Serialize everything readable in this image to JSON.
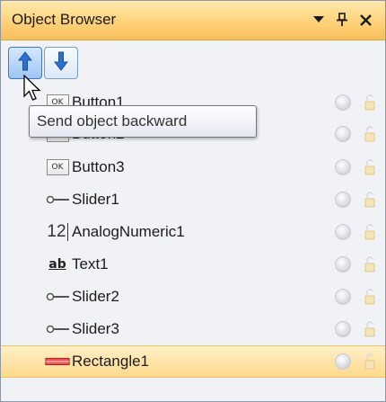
{
  "panel": {
    "title": "Object Browser",
    "dropdown_glyph": "▾",
    "pin_glyph": "ᵠ",
    "close_glyph": "✕"
  },
  "toolbar": {
    "bring_forward_icon": "arrow-up-icon",
    "send_backward_icon": "arrow-down-icon"
  },
  "tooltip": {
    "text": "Send object backward"
  },
  "objects": [
    {
      "label": "Button1",
      "icon": "button-icon",
      "icon_text": "OK",
      "selected": false
    },
    {
      "label": "Button2",
      "icon": "button-icon",
      "icon_text": "OK",
      "selected": false
    },
    {
      "label": "Button3",
      "icon": "button-icon",
      "icon_text": "OK",
      "selected": false
    },
    {
      "label": "Slider1",
      "icon": "slider-icon",
      "selected": false
    },
    {
      "label": "AnalogNumeric1",
      "icon": "numeric-icon",
      "icon_text": "12",
      "selected": false
    },
    {
      "label": "Text1",
      "icon": "text-icon",
      "icon_text": "ab",
      "selected": false
    },
    {
      "label": "Slider2",
      "icon": "slider-icon",
      "selected": false
    },
    {
      "label": "Slider3",
      "icon": "slider-icon",
      "selected": false
    },
    {
      "label": "Rectangle1",
      "icon": "rectangle-icon",
      "selected": true
    }
  ],
  "colors": {
    "selection": "#ffd98c",
    "titlebar": "#ffd27a",
    "accent": "#3e78c0"
  }
}
